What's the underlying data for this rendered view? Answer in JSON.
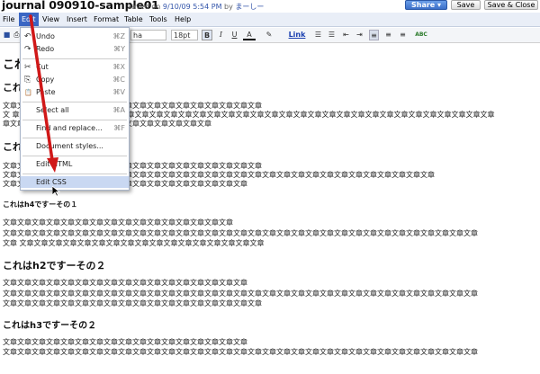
{
  "title_bar": {
    "doc_title": "journal 090910-sample01",
    "saved_prefix": "saved on",
    "saved_date": "9/10/09 5:54 PM",
    "saved_by": "by",
    "saved_user": "まーしー",
    "share_label": "Share ▾",
    "save_label": "Save",
    "save_close_label": "Save & Close"
  },
  "menu": [
    "File",
    "Edit",
    "View",
    "Insert",
    "Format",
    "Table",
    "Tools",
    "Help"
  ],
  "toolbar": {
    "font_value": "ha",
    "size_value": "18pt",
    "bold": "B",
    "italic": "I",
    "underline": "U",
    "text_color": "A",
    "highlight": "✎",
    "link": "Link",
    "spell": "ABC"
  },
  "edit_menu": {
    "items": [
      {
        "label": "Undo",
        "shortcut": "⌘Z",
        "icon": "↶"
      },
      {
        "label": "Redo",
        "shortcut": "⌘Y",
        "icon": "↷"
      },
      {
        "label": "Cut",
        "shortcut": "⌘X",
        "icon": "✂"
      },
      {
        "label": "Copy",
        "shortcut": "⌘C",
        "icon": "⎘"
      },
      {
        "label": "Paste",
        "shortcut": "⌘V",
        "icon": "📋"
      },
      {
        "label": "Select all",
        "shortcut": "⌘A",
        "icon": ""
      },
      {
        "label": "Find and replace...",
        "shortcut": "⌘F",
        "icon": ""
      },
      {
        "label": "Document styles...",
        "shortcut": "",
        "icon": ""
      },
      {
        "label": "Edit HTML",
        "shortcut": "",
        "icon": ""
      },
      {
        "label": "Edit CSS",
        "shortcut": "",
        "icon": ""
      }
    ]
  },
  "document": {
    "h1_a": "これ",
    "h2_a": "これは",
    "para1_l1": "文章文章文章文章文章文章文章文章文章文章文章文章文章文章文章文章文章文章",
    "para1_l2": "文 章文章文章文章文章文章文章文章文章文章文章文章文章文章文章文章文章文章文章文章文章文章文章文章文章文章文章文章文章文章文章文章文章文章",
    "para1_l3": "章文章文章文章文章文章文章文章文章文章文章文章文章文章文章",
    "h3_a": "これ",
    "para2_l1": "文章文章文章文章文章文章文章文章文章文章文章文章文章文章文章文章文章文章",
    "para2_l2": "文章文章文章文章文章文章文章文章文章文章文章文章文章文章文章文章文章文章文章文章文章文章文章文章文章文章文章文章文章文章",
    "para2_l3": "文章文章文章文章文章文章文章文章文章文章文章文章文章文章文章文章文章",
    "h4_a": "これはh4ですーその１",
    "para3_l1": "文章文章文章文章文章文章文章文章文章文章文章文章文章文章文章文章",
    "para3_l2": "文章文章文章文章文章文章文章文章文章文章文章文章文章文章文章文章文章文章文章文章文章文章文章文章文章文章文章文章文章文章文章文章文章",
    "para3_l3": "文章 文章文章文章文章文章文章文章文章文章文章文章文章文章文章文章文章文章",
    "h2_b": "これはh2ですーその２",
    "para4_l1": "文章文章文章文章文章文章文章文章文章文章文章文章文章文章文章文章文章",
    "para4_l2": "文章文章文章文章文章文章文章文章文章文章文章文章文章文章文章文章文章文章文章文章文章文章文章文章文章文章文章文章文章文章文章文章文章",
    "para4_l3": "文章文章文章文章文章文章文章文章文章文章文章文章文章文章文章文章文章文章",
    "h3_b": "これはh3ですーその２",
    "para5_l1": "文章文章文章文章文章文章文章文章文章文章文章文章文章文章文章文章文章",
    "para5_l2": "文章文章文章文章文章文章文章文章文章文章文章文章文章文章文章文章文章文章文章文章文章文章文章文章文章文章文章文章文章文章文章文章文章"
  },
  "colors": {
    "menu_active": "#3a66c4",
    "share_button": "#3c6fc8",
    "annotation_arrow": "#d01818"
  }
}
